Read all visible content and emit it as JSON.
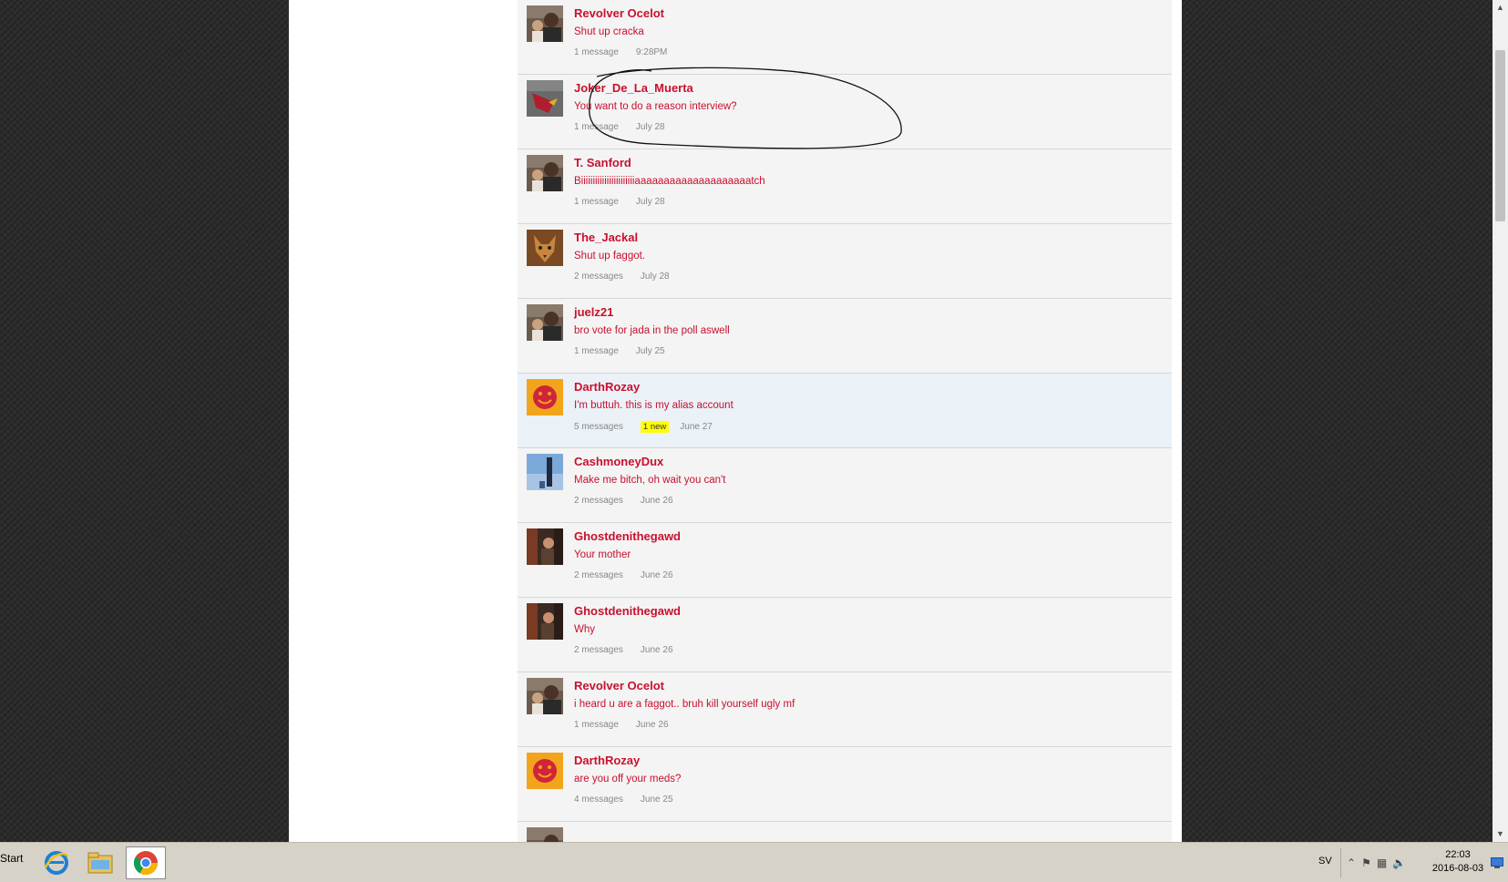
{
  "conversations": [
    {
      "sender": "Revolver Ocelot",
      "snippet": "Shut up cracka",
      "count": "1 message",
      "date": "9:28PM",
      "avatar": "person-avatar"
    },
    {
      "sender": "Joker_De_La_Muerta",
      "snippet": "You want to do a reason interview?",
      "count": "1 message",
      "date": "July 28",
      "avatar": "cardinals-avatar"
    },
    {
      "sender": "T. Sanford",
      "snippet": "Biiiiiiiiiiiiiiiiiiiiiiiaaaaaaaaaaaaaaaaaaaatch",
      "count": "1 message",
      "date": "July 28",
      "avatar": "person-avatar"
    },
    {
      "sender": "The_Jackal",
      "snippet": "Shut up faggot.",
      "count": "2 messages",
      "date": "July 28",
      "avatar": "jackal-avatar"
    },
    {
      "sender": "juelz21",
      "snippet": "bro vote for jada in the poll aswell",
      "count": "1 message",
      "date": "July 25",
      "avatar": "person-avatar"
    },
    {
      "sender": "DarthRozay",
      "snippet": "I'm buttuh. this is my alias account",
      "count": "5 messages",
      "badge": "1 new",
      "date": "June 27",
      "avatar": "smiley-avatar",
      "unread": true
    },
    {
      "sender": "CashmoneyDux",
      "snippet": "Make me bitch, oh wait you can't",
      "count": "2 messages",
      "date": "June 26",
      "avatar": "blue-avatar"
    },
    {
      "sender": "Ghostdenithegawd",
      "snippet": "Your mother",
      "count": "2 messages",
      "date": "June 26",
      "avatar": "dark-avatar"
    },
    {
      "sender": "Ghostdenithegawd",
      "snippet": "Why",
      "count": "2 messages",
      "date": "June 26",
      "avatar": "dark-avatar"
    },
    {
      "sender": "Revolver Ocelot",
      "snippet": "i heard u are a faggot.. bruh kill yourself ugly mf",
      "count": "1 message",
      "date": "June 26",
      "avatar": "person-avatar"
    },
    {
      "sender": "DarthRozay",
      "snippet": "are you off your meds?",
      "count": "4 messages",
      "date": "June 25",
      "avatar": "smiley-avatar"
    }
  ],
  "taskbar": {
    "start_label": "Start",
    "apps": [
      "internet-explorer-icon",
      "file-explorer-icon",
      "chrome-icon"
    ],
    "language": "SV",
    "time": "22:03",
    "date": "2016-08-03"
  },
  "colors": {
    "link_red": "#c8102e",
    "new_badge": "#ffff00",
    "list_bg": "#f4f4f4",
    "unread_bg": "#eaf1f7"
  }
}
